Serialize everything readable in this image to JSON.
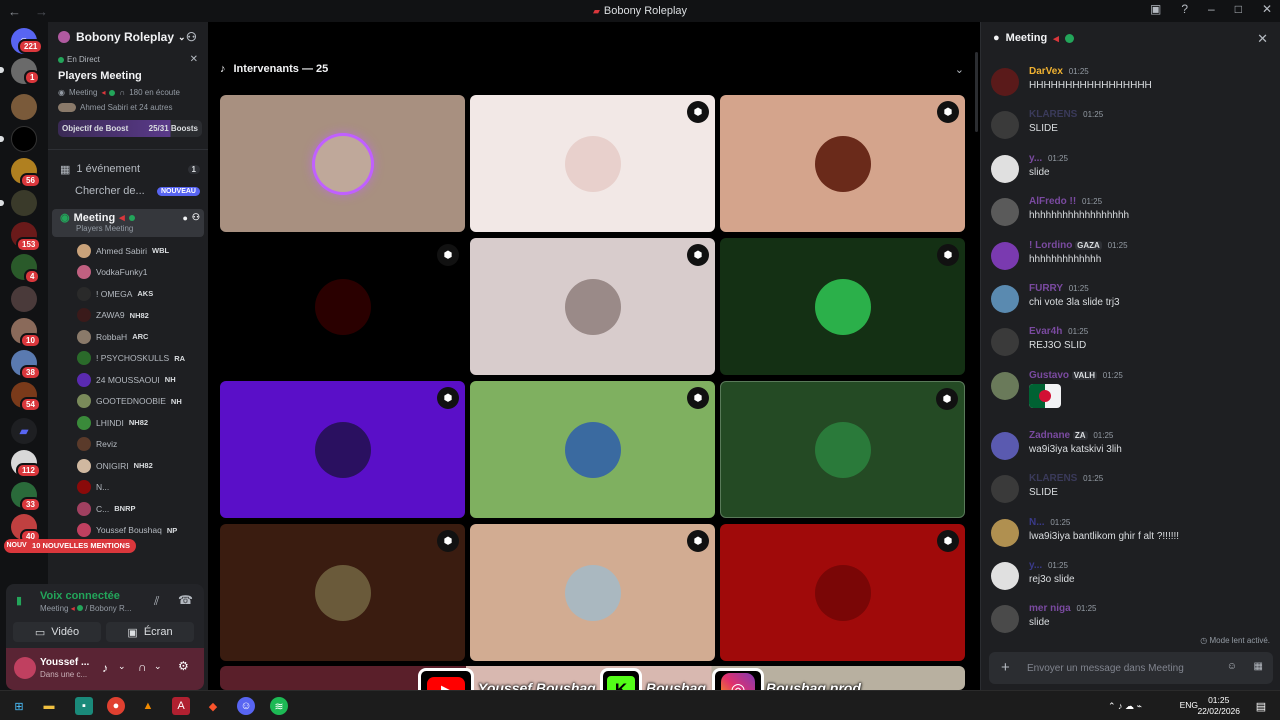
{
  "window": {
    "title": "Bobony Roleplay"
  },
  "rail": {
    "badges": [
      "221",
      "1",
      "56",
      "153",
      "4",
      "10",
      "38",
      "54",
      "112",
      "33",
      "40"
    ],
    "new_label": "NOUVEAU"
  },
  "server": {
    "name": "Bobony Roleplay",
    "live_label": "En Direct",
    "event_title": "Players Meeting",
    "meta": "Meeting",
    "listeners": "180 en écoute",
    "participants": "Ahmed Sabiri et 24 autres",
    "boost_label": "Objectif de Boost",
    "boost_progress": "25/31 Boosts",
    "boost_fraction": 0.806,
    "events_label": "1 événement",
    "events_count": "1",
    "search_label": "Chercher de...",
    "search_badge": "NOUVEAU"
  },
  "voice_channel": {
    "name": "Meeting",
    "subtitle": "Players Meeting",
    "members": [
      {
        "name": "Ahmed Sabiri",
        "tag": "WBL",
        "color": "#c9a27a"
      },
      {
        "name": "VodkaFunky1",
        "tag": "",
        "color": "#c06080"
      },
      {
        "name": "! OMEGA",
        "tag": "AKS",
        "color": "#2a2a2a"
      },
      {
        "name": "ZAWA9",
        "tag": "NH82",
        "color": "#3a1a1a"
      },
      {
        "name": "RobbaH",
        "tag": "ARC",
        "color": "#8a7a6a"
      },
      {
        "name": "! PSYCHOSKULLS",
        "tag": "RA",
        "color": "#2a6a2a"
      },
      {
        "name": "24 MOUSSAOUI",
        "tag": "NH",
        "color": "#5a2ab0"
      },
      {
        "name": "GOOTEDNOOBIE",
        "tag": "NH",
        "color": "#7a8a5a"
      },
      {
        "name": "LHINDI",
        "tag": "NH82",
        "color": "#3a8a3a"
      },
      {
        "name": "Reviz",
        "tag": "",
        "color": "#5a3a2a"
      },
      {
        "name": "ONIGIRI",
        "tag": "NH82",
        "color": "#d0b8a0"
      },
      {
        "name": "N...",
        "tag": "",
        "color": "#8a0a0a"
      },
      {
        "name": "C...",
        "tag": "BNRP",
        "color": "#a04060"
      },
      {
        "name": "Youssef Boushaq",
        "tag": "NP",
        "color": "#c04060"
      }
    ],
    "mentions_label": "10 NOUVELLES MENTIONS"
  },
  "voice_panel": {
    "status": "Voix connectée",
    "channel": "Meeting",
    "server": "/ Bobony R...",
    "video_label": "Vidéo",
    "screen_label": "Écran"
  },
  "user_panel": {
    "name": "Youssef ...",
    "status": "Dans une c..."
  },
  "stage": {
    "header": "Intervenants — 25",
    "tiles": [
      {
        "bg": "#a89080",
        "av": "#bfa89a",
        "shield": false
      },
      {
        "bg": "#f2e8e6",
        "av": "#e8d0cc",
        "shield": true
      },
      {
        "bg": "#d4a48c",
        "av": "#6a2a1a",
        "shield": true
      },
      {
        "bg": "#000000",
        "av": "#2a0000",
        "shield": true
      },
      {
        "bg": "#d8cccc",
        "av": "#9a8a88",
        "shield": true
      },
      {
        "bg": "#143014",
        "av": "#2bb04a",
        "shield": true
      },
      {
        "bg": "#5a0fc8",
        "av": "#2a1060",
        "shield": true
      },
      {
        "bg": "#7fb060",
        "av": "#3a6aa0",
        "shield": true
      },
      {
        "bg": "#244a24",
        "av": "#2a7a3a",
        "shield": true
      },
      {
        "bg": "#3a1c10",
        "av": "#6a5a3a",
        "shield": true
      },
      {
        "bg": "#d2ac92",
        "av": "#aab8c0",
        "shield": true
      },
      {
        "bg": "#a00a0a",
        "av": "#7a0606",
        "shield": true
      }
    ]
  },
  "chat": {
    "title": "Meeting",
    "messages": [
      {
        "name": "DarVex",
        "time": "01:25",
        "text": "HHHHHHHHHHHHHHHHH",
        "color": "#f0b232",
        "av": "#5a1a1a"
      },
      {
        "name": "KLARENS",
        "time": "01:25",
        "text": "SLIDE",
        "color": "#3a3a5a",
        "av": "#3a3a3a"
      },
      {
        "name": "y...",
        "time": "01:25",
        "text": "slide",
        "color": "#7a4aa0",
        "av": "#e0e0e0"
      },
      {
        "name": "AlFredo !!",
        "time": "01:25",
        "text": "hhhhhhhhhhhhhhhhhh",
        "color": "#7a4aa0",
        "av": "#5a5a5a"
      },
      {
        "name": "! Lordino",
        "time": "01:25",
        "text": "hhhhhhhhhhhhh",
        "color": "#7a4aa0",
        "av": "#7a3ab0",
        "tag": "GAZA"
      },
      {
        "name": "FURRY",
        "time": "01:25",
        "text": "chi vote 3la slide trj3",
        "color": "#7a4aa0",
        "av": "#5a8ab0"
      },
      {
        "name": "Evar4h",
        "time": "01:25",
        "text": "REJ3O SLID",
        "color": "#7a4aa0",
        "av": "#3a3a3a"
      },
      {
        "name": "Gustavo",
        "time": "01:25",
        "text": "",
        "color": "#7a4aa0",
        "av": "#6a7a5a",
        "tag": "VALH",
        "flag": true
      },
      {
        "name": "Zadnane",
        "time": "01:25",
        "text": "wa9i3iya katskivi 3lih",
        "color": "#7a4aa0",
        "av": "#5a5ab0",
        "tag": "ZA"
      },
      {
        "name": "KLARENS",
        "time": "01:25",
        "text": "SLIDE",
        "color": "#3a3a5a",
        "av": "#3a3a3a"
      },
      {
        "name": "N...",
        "time": "01:25",
        "text": "lwa9i3iya bantlikom ghir f alt ?!!!!!!",
        "color": "#3a3a8a",
        "av": "#b09050"
      },
      {
        "name": "y...",
        "time": "01:25",
        "text": "rej3o slide",
        "color": "#3a3a8a",
        "av": "#e0e0e0"
      },
      {
        "name": "mer niga",
        "time": "01:25",
        "text": "slide",
        "color": "#7a4aa0",
        "av": "#4a4a4a"
      }
    ],
    "slow_mode": "Mode lent activé.",
    "input_placeholder": "Envoyer un message dans Meeting"
  },
  "overlay": {
    "youtube": "Youssef Boushaq",
    "kick": "Boushaq",
    "instagram": "Boushaq.prod"
  },
  "taskbar": {
    "lang": "ENG",
    "time": "01:25",
    "date": "22/02/2026"
  }
}
